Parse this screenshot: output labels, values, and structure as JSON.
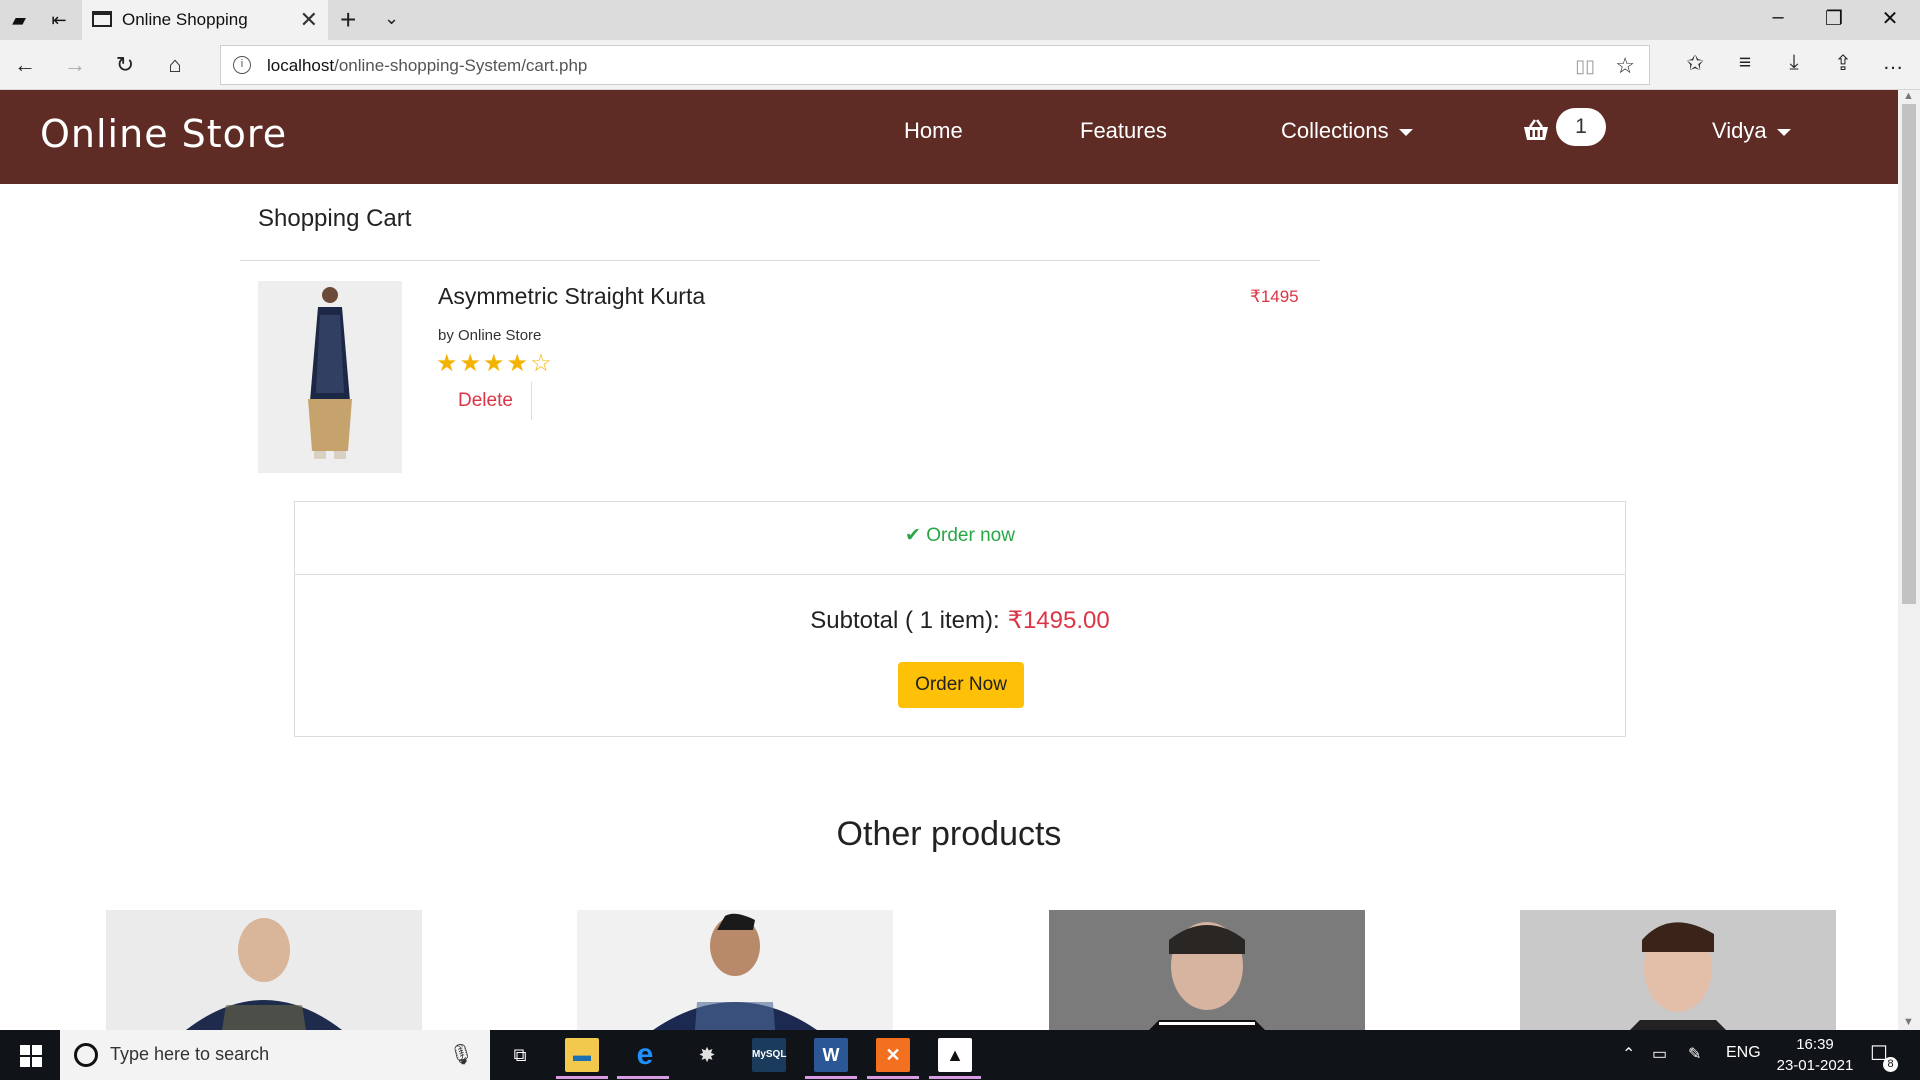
{
  "browser": {
    "tab_title": "Online Shopping",
    "url_host": "localhost",
    "url_path": "/online-shopping-System/cart.php",
    "icons": [
      "back-icon",
      "forward-icon",
      "refresh-icon",
      "home-icon",
      "favorites-icon",
      "reading-list-icon",
      "download-icon",
      "share-icon",
      "more-icon"
    ]
  },
  "site": {
    "brand": "Online Store",
    "nav": {
      "home": "Home",
      "features": "Features",
      "collections": "Collections",
      "cart_count": "1",
      "user": "Vidya"
    }
  },
  "cart": {
    "heading": "Shopping Cart",
    "item": {
      "name": "Asymmetric Straight Kurta",
      "seller": "by Online Store",
      "rating": 4,
      "rating_max": 5,
      "delete_label": "Delete",
      "price": "₹1495"
    },
    "order_link": "Order now",
    "subtotal_label": "Subtotal ( 1 item):",
    "subtotal_amount": "₹1495.00",
    "order_button": "Order Now"
  },
  "other": {
    "heading": "Other products"
  },
  "taskbar": {
    "search_placeholder": "Type here to search",
    "lang": "ENG",
    "time": "16:39",
    "date": "23-01-2021",
    "notifications": "8"
  },
  "colors": {
    "header_bg": "#5f2c25",
    "price": "#dc3545",
    "order_green": "#28a745",
    "button_yellow": "#ffc107",
    "star": "#f5b301"
  }
}
